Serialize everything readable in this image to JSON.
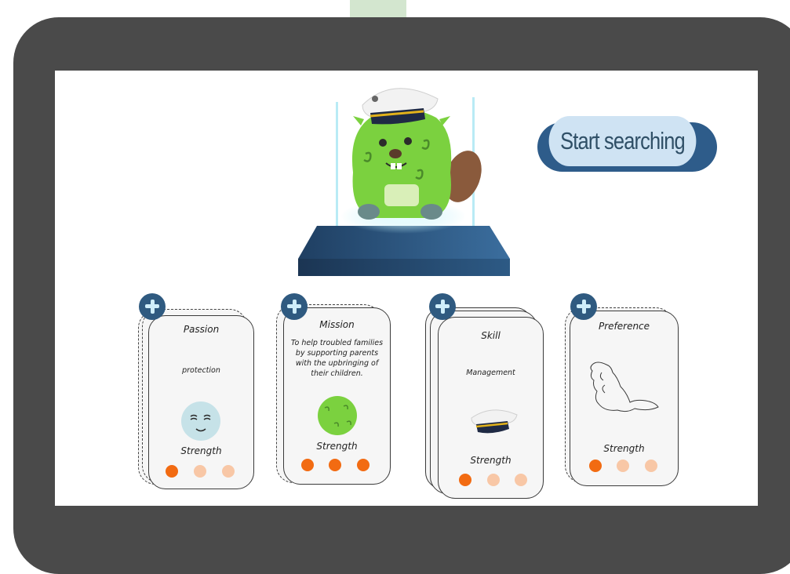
{
  "search_button": {
    "label": "Start searching"
  },
  "cards": [
    {
      "title": "Passion",
      "text": "protection",
      "strength_label": "Strength",
      "strength": 1,
      "icon": "sleepy-face-icon"
    },
    {
      "title": "Mission",
      "text": "To help troubled families by supporting parents with the upbringing of their children.",
      "strength_label": "Strength",
      "strength": 3,
      "icon": "green-ball-icon"
    },
    {
      "title": "Skill",
      "text": "Management",
      "strength_label": "Strength",
      "strength": 1,
      "icon": "captain-hat-icon"
    },
    {
      "title": "Preference",
      "text": "",
      "strength_label": "Strength",
      "strength": 1,
      "icon": "beaver-outline-icon"
    }
  ],
  "colors": {
    "dot_active": "#f26b12",
    "dot_inactive": "#f8c7a6",
    "plus_bg": "#2f5a80",
    "frame": "#4a4a4a"
  }
}
